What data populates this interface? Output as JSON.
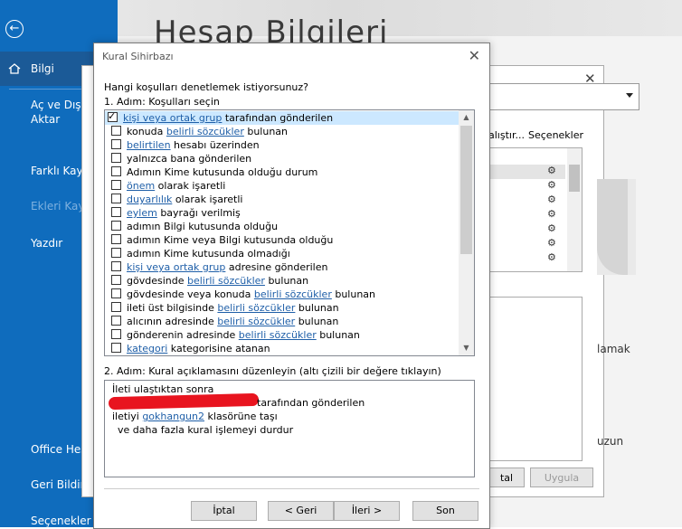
{
  "nav": {
    "items": [
      "Bilgi",
      "Aç ve Dışarı",
      "Aktar",
      "Farklı Kaydet",
      "Ekleri Kaydet",
      "Yazdır",
      "Office Hes",
      "Geri Bildirim",
      "Seçenekler"
    ]
  },
  "page": {
    "title": "Hesap Bilgileri"
  },
  "background_dialog": {
    "toolbar_left": "alıştır...",
    "toolbar_right": "Seçenekler",
    "side_text_1": "lamak",
    "side_text_2": "uzun",
    "button_left": "tal",
    "button_apply": "Uygula"
  },
  "dialog": {
    "title": "Kural Sihirbazı",
    "question": "Hangi koşulları denetlemek istiyorsunuz?",
    "step1": "1. Adım: Koşulları seçin",
    "conditions": [
      {
        "pre": "",
        "link": "kişi veya ortak grup",
        "post": " tarafından gönderilen",
        "checked": true
      },
      {
        "pre": "konuda ",
        "link": "belirli sözcükler",
        "post": " bulunan",
        "checked": false
      },
      {
        "pre": "",
        "link": "belirtilen",
        "post": " hesabı üzerinden",
        "checked": false
      },
      {
        "pre": "yalnızca bana gönderilen",
        "link": "",
        "post": "",
        "checked": false
      },
      {
        "pre": "Adımın Kime kutusunda olduğu durum",
        "link": "",
        "post": "",
        "checked": false
      },
      {
        "pre": "",
        "link": "önem",
        "post": " olarak işaretli",
        "checked": false
      },
      {
        "pre": "",
        "link": "duyarlılık",
        "post": " olarak işaretli",
        "checked": false
      },
      {
        "pre": "",
        "link": "eylem",
        "post": " bayrağı verilmiş",
        "checked": false
      },
      {
        "pre": "adımın Bilgi kutusunda olduğu",
        "link": "",
        "post": "",
        "checked": false
      },
      {
        "pre": "adımın Kime veya Bilgi kutusunda olduğu",
        "link": "",
        "post": "",
        "checked": false
      },
      {
        "pre": "adımın Kime kutusunda olmadığı",
        "link": "",
        "post": "",
        "checked": false
      },
      {
        "pre": "",
        "link": "kişi veya ortak grup",
        "post": " adresine gönderilen",
        "checked": false
      },
      {
        "pre": "gövdesinde ",
        "link": "belirli sözcükler",
        "post": " bulunan",
        "checked": false
      },
      {
        "pre": "gövdesinde veya konuda ",
        "link": "belirli sözcükler",
        "post": " bulunan",
        "checked": false
      },
      {
        "pre": "ileti üst bilgisinde ",
        "link": "belirli sözcükler",
        "post": " bulunan",
        "checked": false
      },
      {
        "pre": "alıcının adresinde ",
        "link": "belirli sözcükler",
        "post": " bulunan",
        "checked": false
      },
      {
        "pre": "gönderenin adresinde ",
        "link": "belirli sözcükler",
        "post": " bulunan",
        "checked": false
      },
      {
        "pre": "",
        "link": "kategori",
        "post": " kategorisine atanan",
        "checked": false
      }
    ],
    "step2": "2. Adım: Kural açıklamasını düzenleyin (altı çizili bir değere tıklayın)",
    "description": {
      "line1": "İleti ulaştıktan sonra",
      "line2_post": "tarafından gönderilen",
      "line3_pre": "iletiyi ",
      "line3_link": "gokhangun2",
      "line3_post": " klasörüne taşı",
      "line4": "ve daha fazla kural işlemeyi durdur"
    },
    "buttons": {
      "cancel": "İptal",
      "back": "< Geri",
      "next": "İleri >",
      "finish": "Son"
    }
  }
}
